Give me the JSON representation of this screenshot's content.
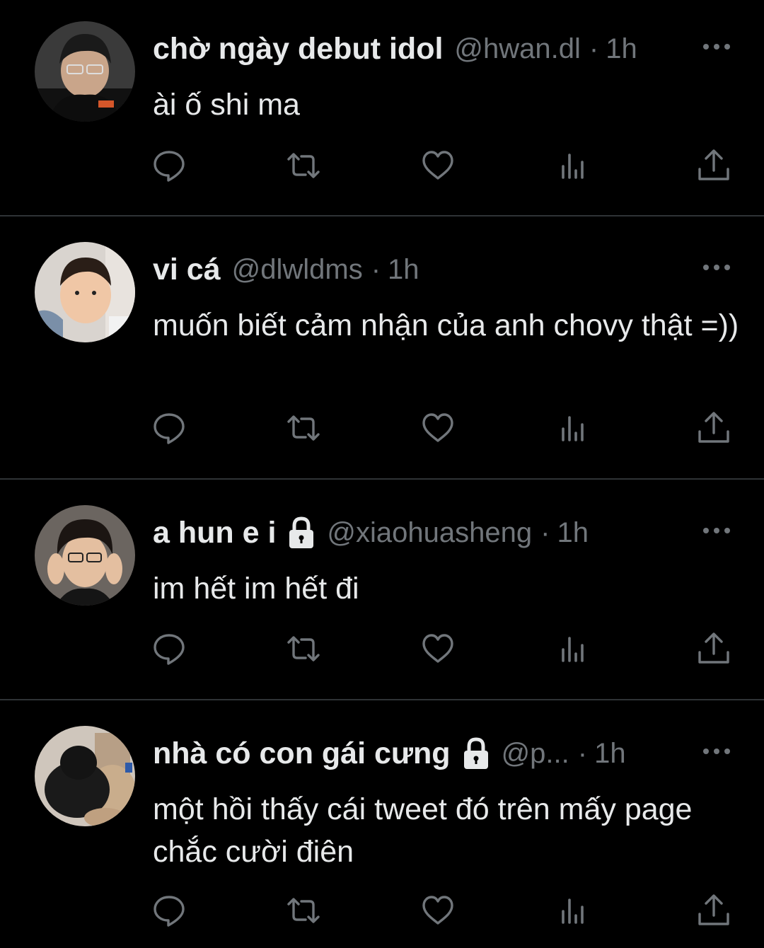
{
  "tweets": [
    {
      "display_name": "chờ ngày debut idol",
      "handle": "@hwan.dl",
      "separator": "·",
      "time": "1h",
      "text": "ài ố shi ma",
      "locked": false
    },
    {
      "display_name": "vi cá",
      "handle": "@dlwldms",
      "separator": "·",
      "time": "1h",
      "text": "muốn biết cảm nhận của anh chovy thật =))",
      "locked": false
    },
    {
      "display_name": "a hun e i",
      "handle": "@xiaohuasheng",
      "separator": "·",
      "time": "1h",
      "text": "im hết im hết đi",
      "locked": true
    },
    {
      "display_name": "nhà có con gái cưng",
      "handle": "@p...",
      "separator": "·",
      "time": "1h",
      "text": "một hồi thấy cái tweet đó trên mấy page chắc cười điên",
      "locked": true
    }
  ],
  "icons": {
    "more": "more-dots-icon",
    "reply": "reply-icon",
    "retweet": "retweet-icon",
    "like": "heart-icon",
    "views": "views-chart-icon",
    "share": "share-icon",
    "lock": "lock-icon"
  },
  "colors": {
    "background": "#000000",
    "primary_text": "#e7e9ea",
    "secondary_text": "#71767b",
    "divider": "#2f3336"
  }
}
